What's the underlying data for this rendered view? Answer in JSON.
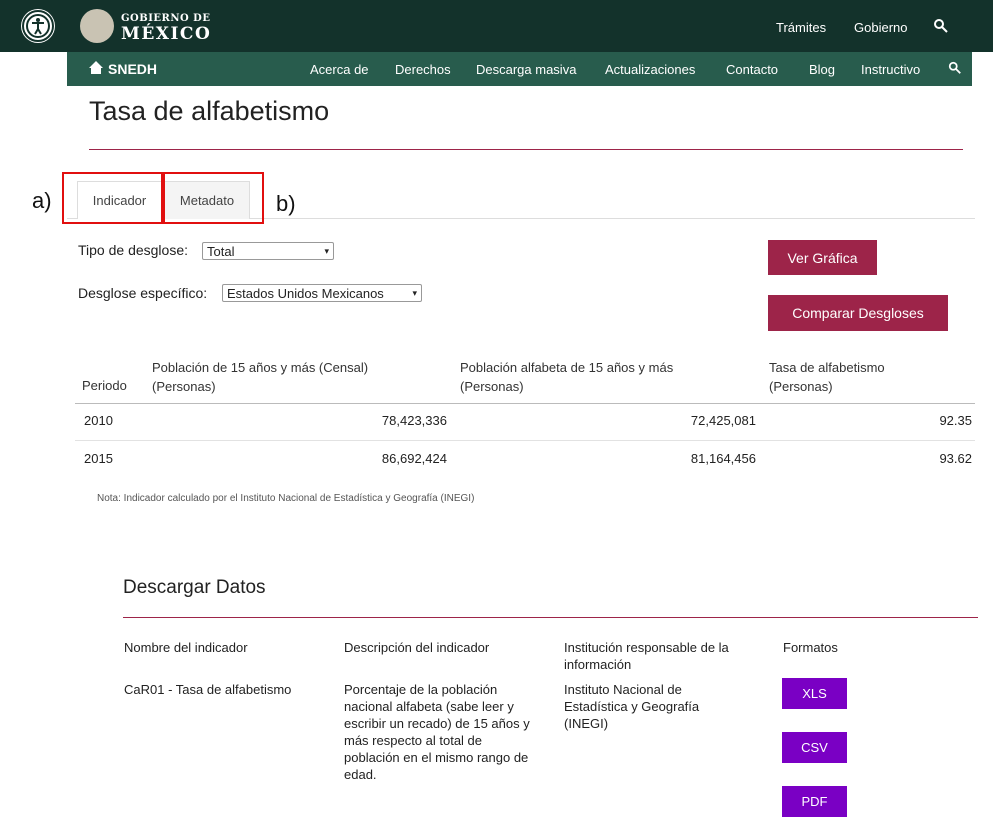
{
  "header": {
    "logo_small": "GOBIERNO DE",
    "logo_big": "MÉXICO",
    "top_links": [
      "Trámites",
      "Gobierno"
    ],
    "brand": "SNEDH",
    "nav_items": [
      "Acerca de",
      "Derechos",
      "Descarga masiva",
      "Actualizaciones",
      "Contacto",
      "Blog",
      "Instructivo"
    ]
  },
  "page": {
    "title": "Tasa de alfabetismo"
  },
  "tabs": [
    {
      "label": "Indicador",
      "annotation": "a)"
    },
    {
      "label": "Metadato",
      "annotation": "b)"
    }
  ],
  "form": {
    "desglose_label": "Tipo de desglose:",
    "desglose_value": "Total",
    "especifico_label": "Desglose específico:",
    "especifico_value": "Estados Unidos Mexicanos",
    "ver_grafica": "Ver Gráfica",
    "comparar": "Comparar Desgloses"
  },
  "table": {
    "headers": [
      "Periodo",
      "Población de 15 años y más (Censal) (Personas)",
      "Población alfabeta de 15 años y más (Personas)",
      "Tasa de alfabetismo (Personas)"
    ],
    "rows": [
      [
        "2010",
        "78,423,336",
        "72,425,081",
        "92.35"
      ],
      [
        "2015",
        "86,692,424",
        "81,164,456",
        "93.62"
      ]
    ],
    "note": "Nota: Indicador calculado por el Instituto Nacional de Estadística y Geografía (INEGI)"
  },
  "download": {
    "title": "Descargar Datos",
    "headers": [
      "Nombre del indicador",
      "Descripción del indicador",
      "Institución responsable de la información",
      "Formatos"
    ],
    "indicator_name": "CaR01 - Tasa de alfabetismo",
    "description": "Porcentaje de la población nacional alfabeta (sabe leer y escribir un recado) de 15 años y más respecto al total de población en el mismo rango de edad.",
    "institution": "Instituto Nacional de Estadística y Geografía (INEGI)",
    "formats": [
      "XLS",
      "CSV",
      "PDF"
    ]
  },
  "colors": {
    "header_dark": "#13322b",
    "nav_green": "#285c4d",
    "accent_red": "#9d2449",
    "format_purple": "#7a00c4"
  }
}
